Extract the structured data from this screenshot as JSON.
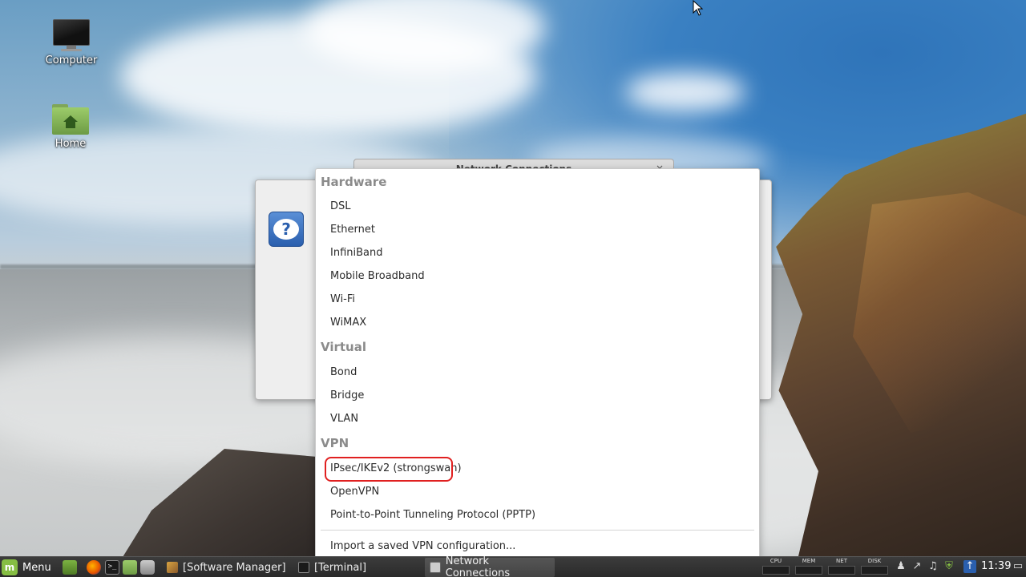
{
  "desktop": {
    "icons": [
      {
        "label": "Computer"
      },
      {
        "label": "Home"
      }
    ]
  },
  "background_window": {
    "title": "Network Connections",
    "close": "×"
  },
  "dialog": {
    "icon": "question-bubble-icon"
  },
  "menu": {
    "sections": [
      {
        "label": "Hardware",
        "items": [
          "DSL",
          "Ethernet",
          "InfiniBand",
          "Mobile Broadband",
          "Wi-Fi",
          "WiMAX"
        ]
      },
      {
        "label": "Virtual",
        "items": [
          "Bond",
          "Bridge",
          "VLAN"
        ]
      },
      {
        "label": "VPN",
        "items": [
          "IPsec/IKEv2 (strongswan)",
          "OpenVPN",
          "Point-to-Point Tunneling Protocol (PPTP)"
        ]
      }
    ],
    "import_label": "Import a saved VPN configuration...",
    "highlighted_item": "IPsec/IKEv2 (strongswan)",
    "highlight_color": "#e02020"
  },
  "taskbar": {
    "menu_label": "Menu",
    "tasks": [
      {
        "label": "[Software Manager]",
        "active": false
      },
      {
        "label": "[Terminal]",
        "active": false
      },
      {
        "label": "Network Connections",
        "active": true
      }
    ],
    "monitors": [
      "CPU",
      "MEM",
      "NET",
      "DISK"
    ],
    "clock": "11:39"
  },
  "colors": {
    "taskbar_bg": "#2f2f2f",
    "mint_green": "#86be43",
    "section_header": "#8b8b8b"
  }
}
